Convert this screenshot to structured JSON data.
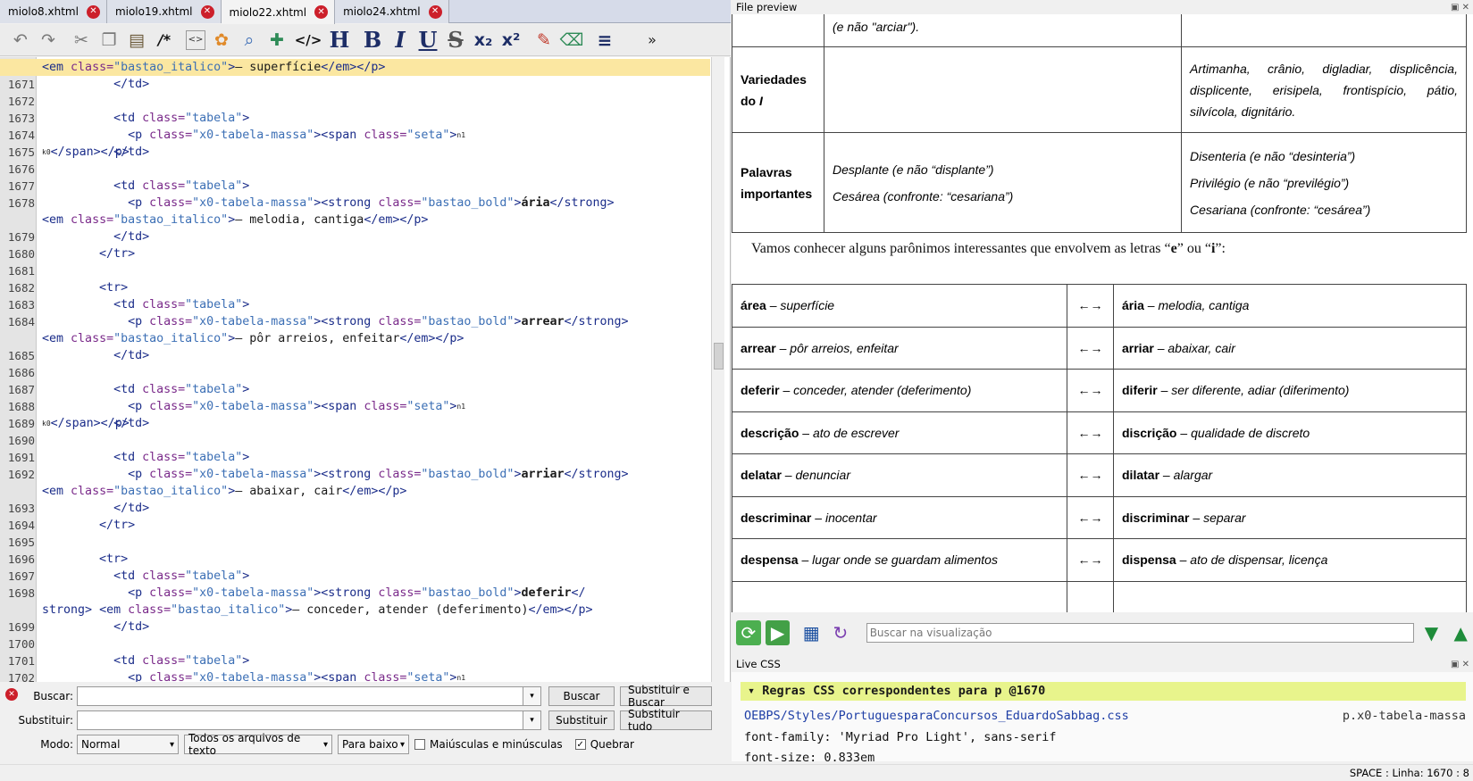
{
  "tabs": [
    {
      "label": "miolo8.xhtml",
      "active": false
    },
    {
      "label": "miolo19.xhtml",
      "active": false
    },
    {
      "label": "miolo22.xhtml",
      "active": true
    },
    {
      "label": "miolo24.xhtml",
      "active": false
    }
  ],
  "toolbar": {
    "icons": [
      "undo-icon",
      "redo-icon",
      "cut-icon",
      "copy-icon",
      "paste-icon",
      "comment-icon",
      "html-icon",
      "tag-icon",
      "zoom-image-icon",
      "insert-icon",
      "code-tag-icon",
      "heading-icon",
      "bold-icon",
      "italic-icon",
      "underline-icon",
      "strikethrough-icon",
      "subscript-icon",
      "superscript-icon",
      "format-brush-icon",
      "clear-format-icon",
      "align-icon",
      "more-icon"
    ],
    "heading_glyph": "H",
    "bold_glyph": "B",
    "italic_glyph": "I",
    "underline_glyph": "U",
    "strike_glyph": "S",
    "sub_glyph": "x₂",
    "sup_glyph": "x²",
    "more_glyph": "»",
    "comment_glyph": "/*",
    "code_glyph": "</>"
  },
  "editor": {
    "lines": [
      {
        "n": "",
        "html": "<span class='t'>&lt;em</span> <span class='a'>class=</span><span class='v'>\"bastao_italico\"</span><span class='t'>&gt;</span>– superfície<span class='t'>&lt;/em&gt;&lt;/p&gt;</span>",
        "hl": true
      },
      {
        "n": "1671",
        "html": "          <span class='t'>&lt;/td&gt;</span>"
      },
      {
        "n": "1672",
        "html": ""
      },
      {
        "n": "1673",
        "html": "          <span class='t'>&lt;td</span> <span class='a'>class=</span><span class='v'>\"tabela\"</span><span class='t'>&gt;</span>"
      },
      {
        "n": "1674",
        "html": "            <span class='t'>&lt;p</span> <span class='a'>class=</span><span class='v'>\"x0-tabela-massa\"</span><span class='t'>&gt;&lt;span</span> <span class='a'>class=</span><span class='v'>\"seta\"</span><span class='t'>&gt;</span>␀<span class='t'>&lt;/span&gt;&lt;/p&gt;</span>"
      },
      {
        "n": "1675",
        "html": "          <span class='t'>&lt;/td&gt;</span>"
      },
      {
        "n": "1676",
        "html": ""
      },
      {
        "n": "1677",
        "html": "          <span class='t'>&lt;td</span> <span class='a'>class=</span><span class='v'>\"tabela\"</span><span class='t'>&gt;</span>"
      },
      {
        "n": "1678",
        "html": "            <span class='t'>&lt;p</span> <span class='a'>class=</span><span class='v'>\"x0-tabela-massa\"</span><span class='t'>&gt;&lt;strong</span> <span class='a'>class=</span><span class='v'>\"bastao_bold\"</span><span class='t'>&gt;</span><b>ária</b><span class='t'>&lt;/strong&gt;</span>"
      },
      {
        "n": "",
        "html": "<span class='t'>&lt;em</span> <span class='a'>class=</span><span class='v'>\"bastao_italico\"</span><span class='t'>&gt;</span>– melodia, cantiga<span class='t'>&lt;/em&gt;&lt;/p&gt;</span>"
      },
      {
        "n": "1679",
        "html": "          <span class='t'>&lt;/td&gt;</span>"
      },
      {
        "n": "1680",
        "html": "        <span class='t'>&lt;/tr&gt;</span>"
      },
      {
        "n": "1681",
        "html": ""
      },
      {
        "n": "1682",
        "html": "        <span class='t'>&lt;tr&gt;</span>"
      },
      {
        "n": "1683",
        "html": "          <span class='t'>&lt;td</span> <span class='a'>class=</span><span class='v'>\"tabela\"</span><span class='t'>&gt;</span>"
      },
      {
        "n": "1684",
        "html": "            <span class='t'>&lt;p</span> <span class='a'>class=</span><span class='v'>\"x0-tabela-massa\"</span><span class='t'>&gt;&lt;strong</span> <span class='a'>class=</span><span class='v'>\"bastao_bold\"</span><span class='t'>&gt;</span><b>arrear</b><span class='t'>&lt;/strong&gt;</span>"
      },
      {
        "n": "",
        "html": "<span class='t'>&lt;em</span> <span class='a'>class=</span><span class='v'>\"bastao_italico\"</span><span class='t'>&gt;</span>– pôr arreios, enfeitar<span class='t'>&lt;/em&gt;&lt;/p&gt;</span>"
      },
      {
        "n": "1685",
        "html": "          <span class='t'>&lt;/td&gt;</span>"
      },
      {
        "n": "1686",
        "html": ""
      },
      {
        "n": "1687",
        "html": "          <span class='t'>&lt;td</span> <span class='a'>class=</span><span class='v'>\"tabela\"</span><span class='t'>&gt;</span>"
      },
      {
        "n": "1688",
        "html": "            <span class='t'>&lt;p</span> <span class='a'>class=</span><span class='v'>\"x0-tabela-massa\"</span><span class='t'>&gt;&lt;span</span> <span class='a'>class=</span><span class='v'>\"seta\"</span><span class='t'>&gt;</span>␀<span class='t'>&lt;/span&gt;&lt;/p&gt;</span>"
      },
      {
        "n": "1689",
        "html": "          <span class='t'>&lt;/td&gt;</span>"
      },
      {
        "n": "1690",
        "html": ""
      },
      {
        "n": "1691",
        "html": "          <span class='t'>&lt;td</span> <span class='a'>class=</span><span class='v'>\"tabela\"</span><span class='t'>&gt;</span>"
      },
      {
        "n": "1692",
        "html": "            <span class='t'>&lt;p</span> <span class='a'>class=</span><span class='v'>\"x0-tabela-massa\"</span><span class='t'>&gt;&lt;strong</span> <span class='a'>class=</span><span class='v'>\"bastao_bold\"</span><span class='t'>&gt;</span><b>arriar</b><span class='t'>&lt;/strong&gt;</span>"
      },
      {
        "n": "",
        "html": "<span class='t'>&lt;em</span> <span class='a'>class=</span><span class='v'>\"bastao_italico\"</span><span class='t'>&gt;</span>– abaixar, cair<span class='t'>&lt;/em&gt;&lt;/p&gt;</span>"
      },
      {
        "n": "1693",
        "html": "          <span class='t'>&lt;/td&gt;</span>"
      },
      {
        "n": "1694",
        "html": "        <span class='t'>&lt;/tr&gt;</span>"
      },
      {
        "n": "1695",
        "html": ""
      },
      {
        "n": "1696",
        "html": "        <span class='t'>&lt;tr&gt;</span>"
      },
      {
        "n": "1697",
        "html": "          <span class='t'>&lt;td</span> <span class='a'>class=</span><span class='v'>\"tabela\"</span><span class='t'>&gt;</span>"
      },
      {
        "n": "1698",
        "html": "            <span class='t'>&lt;p</span> <span class='a'>class=</span><span class='v'>\"x0-tabela-massa\"</span><span class='t'>&gt;&lt;strong</span> <span class='a'>class=</span><span class='v'>\"bastao_bold\"</span><span class='t'>&gt;</span><b>deferir</b><span class='t'>&lt;/</span>"
      },
      {
        "n": "",
        "html": "<span class='t'>strong&gt;</span> <span class='t'>&lt;em</span> <span class='a'>class=</span><span class='v'>\"bastao_italico\"</span><span class='t'>&gt;</span>– conceder, atender (deferimento)<span class='t'>&lt;/em&gt;&lt;/p&gt;</span>"
      },
      {
        "n": "1699",
        "html": "          <span class='t'>&lt;/td&gt;</span>"
      },
      {
        "n": "1700",
        "html": ""
      },
      {
        "n": "1701",
        "html": "          <span class='t'>&lt;td</span> <span class='a'>class=</span><span class='v'>\"tabela\"</span><span class='t'>&gt;</span>"
      },
      {
        "n": "1702",
        "html": "            <span class='t'>&lt;p</span> <span class='a'>class=</span><span class='v'>\"x0-tabela-massa\"</span><span class='t'>&gt;&lt;span</span> <span class='a'>class=</span><span class='v'>\"seta\"</span><span class='t'>&gt;</span>␀<span class='t'>&lt;/span&gt;&lt;/p&gt;</span>"
      }
    ]
  },
  "find": {
    "buscar_label": "Buscar:",
    "substituir_label": "Substituir:",
    "modo_label": "Modo:",
    "buscar_btn": "Buscar",
    "subst_buscar_btn": "Substituir e Buscar",
    "subst_btn": "Substituir",
    "subst_tudo_btn": "Substituir tudo",
    "mode_value": "Normal",
    "scope_value": "Todos os arquivos de texto",
    "direction_value": "Para baixo",
    "case_label": "Maiúsculas e minúsculas",
    "wrap_label": "Quebrar",
    "wrap_check": "✓"
  },
  "preview": {
    "title": "File preview",
    "top_cell_text": "(e não \"arciar\").",
    "row_var": {
      "label": "Variedades do ",
      "label_em": "I",
      "c2": "",
      "c3": "Artimanha, crânio, digladiar, displicência, displicente, erisipela, frontispício, pátio, silvícola, dignitário."
    },
    "row_pal": {
      "label": "Palavras importantes",
      "c2a": "Desplante (e não “displante”)",
      "c2b": "Cesárea (confronte: “cesariana”)",
      "c3a": "Disenteria (e não “desinteria”)",
      "c3b": "Privilégio (e não “previlégio”)",
      "c3c": "Cesariana (confronte: “cesárea”)"
    },
    "para_pre": "Vamos conhecer alguns parônimos interessantes que envolvem as letras “",
    "para_e": "e",
    "para_mid": "” ou “",
    "para_i": "i",
    "para_post": "”:",
    "arrow": "←→",
    "pairs": [
      {
        "lw": "área",
        "ld": "superfície",
        "rw": "ária",
        "rd": "melodia, cantiga"
      },
      {
        "lw": "arrear",
        "ld": "pôr arreios, enfeitar",
        "rw": "arriar",
        "rd": "abaixar, cair"
      },
      {
        "lw": "deferir",
        "ld": "conceder, atender (deferimento)",
        "rw": "diferir",
        "rd": "ser diferente, adiar (diferimento)"
      },
      {
        "lw": "descrição",
        "ld": "ato de escrever",
        "rw": "discrição",
        "rd": "qualidade de discreto"
      },
      {
        "lw": "delatar",
        "ld": "denunciar",
        "rw": "dilatar",
        "rd": "alargar"
      },
      {
        "lw": "descriminar",
        "ld": "inocentar",
        "rw": "discriminar",
        "rd": "separar"
      },
      {
        "lw": "despensa",
        "ld": "lugar onde se guardam alimentos",
        "rw": "dispensa",
        "rd": "ato de dispensar, licença"
      }
    ],
    "dash": " – ",
    "search_placeholder": "Buscar na visualização"
  },
  "livecss": {
    "title": "Live CSS",
    "header": "▾ Regras CSS correspondentes para p @1670",
    "file": "OEBPS/Styles/PortuguesparaConcursos_EduardoSabbag.css",
    "selector": "p.x0-tabela-massa",
    "rule1": "font-family: 'Myriad Pro Light', sans-serif",
    "rule2": "font-size: 0.833em"
  },
  "status": "SPACE : Linha: 1670 : 8"
}
